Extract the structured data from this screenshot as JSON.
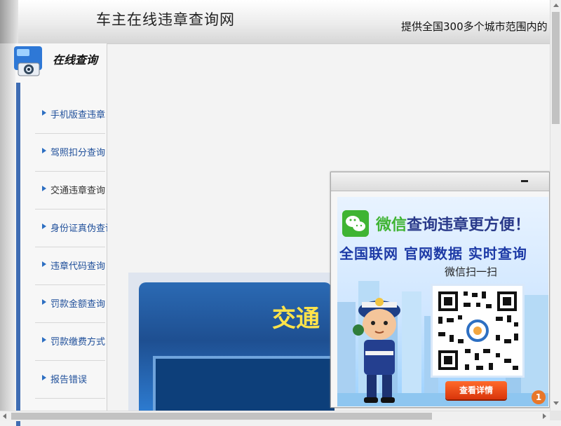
{
  "header": {
    "title": "车主在线违章查询网",
    "tagline": "提供全国300多个城市范围内的"
  },
  "sidebar": {
    "heading": "在线查询",
    "items": [
      {
        "label": "手机版查违章"
      },
      {
        "label": "驾照扣分查询"
      },
      {
        "label": "交通违章查询"
      },
      {
        "label": "身份证真伪查询"
      },
      {
        "label": "违章代码查询"
      },
      {
        "label": "罚款金额查询"
      },
      {
        "label": "罚款缴费方式"
      },
      {
        "label": "报告错误"
      }
    ]
  },
  "main": {
    "banner_title": "交通"
  },
  "popup": {
    "minimize_symbol": "−",
    "ad": {
      "brand": "微信",
      "headline_rest": "查询违章更方便！",
      "subline": "全国联网 官网数据 实时查询",
      "scan_hint": "微信扫一扫",
      "detail_button": "查看详情",
      "badge_count": "1"
    }
  },
  "colors": {
    "menu_link": "#1f4f9a",
    "menu_arrow": "#2d6fc2",
    "banner_title": "#ffe34a",
    "detail_button": "#e24c14",
    "wechat_green": "#3fb433"
  }
}
